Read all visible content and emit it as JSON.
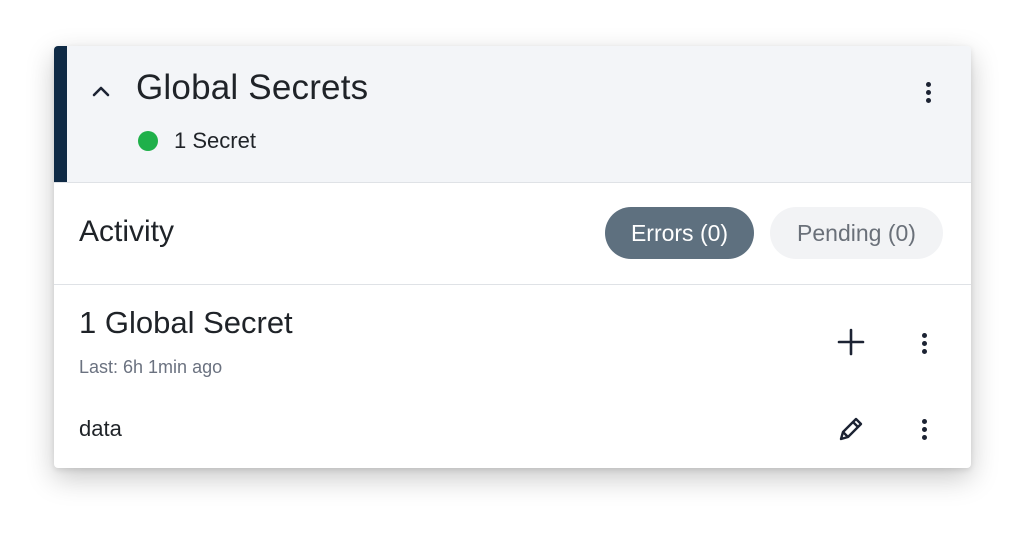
{
  "header": {
    "title": "Global Secrets",
    "status_text": "1 Secret",
    "status_color": "#1fb04a",
    "accent_color": "#0f2a45",
    "collapse_icon": "chevron-up-icon",
    "menu_icon": "more-vertical-icon"
  },
  "activity": {
    "title": "Activity",
    "errors_label": "Errors (0)",
    "pending_label": "Pending (0)"
  },
  "section": {
    "title": "1 Global Secret",
    "subtitle": "Last: 6h 1min ago",
    "add_icon": "plus-icon",
    "menu_icon": "more-vertical-icon",
    "items": [
      {
        "label": "data",
        "edit_icon": "pencil-icon",
        "menu_icon": "more-vertical-icon"
      }
    ]
  }
}
